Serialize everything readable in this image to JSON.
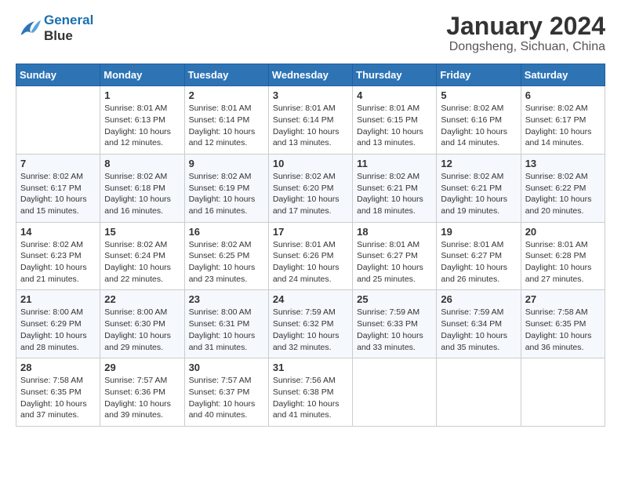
{
  "header": {
    "logo_line1": "General",
    "logo_line2": "Blue",
    "title": "January 2024",
    "subtitle": "Dongsheng, Sichuan, China"
  },
  "calendar": {
    "headers": [
      "Sunday",
      "Monday",
      "Tuesday",
      "Wednesday",
      "Thursday",
      "Friday",
      "Saturday"
    ],
    "rows": [
      [
        {
          "day": "",
          "info": ""
        },
        {
          "day": "1",
          "info": "Sunrise: 8:01 AM\nSunset: 6:13 PM\nDaylight: 10 hours\nand 12 minutes."
        },
        {
          "day": "2",
          "info": "Sunrise: 8:01 AM\nSunset: 6:14 PM\nDaylight: 10 hours\nand 12 minutes."
        },
        {
          "day": "3",
          "info": "Sunrise: 8:01 AM\nSunset: 6:14 PM\nDaylight: 10 hours\nand 13 minutes."
        },
        {
          "day": "4",
          "info": "Sunrise: 8:01 AM\nSunset: 6:15 PM\nDaylight: 10 hours\nand 13 minutes."
        },
        {
          "day": "5",
          "info": "Sunrise: 8:02 AM\nSunset: 6:16 PM\nDaylight: 10 hours\nand 14 minutes."
        },
        {
          "day": "6",
          "info": "Sunrise: 8:02 AM\nSunset: 6:17 PM\nDaylight: 10 hours\nand 14 minutes."
        }
      ],
      [
        {
          "day": "7",
          "info": "Sunrise: 8:02 AM\nSunset: 6:17 PM\nDaylight: 10 hours\nand 15 minutes."
        },
        {
          "day": "8",
          "info": "Sunrise: 8:02 AM\nSunset: 6:18 PM\nDaylight: 10 hours\nand 16 minutes."
        },
        {
          "day": "9",
          "info": "Sunrise: 8:02 AM\nSunset: 6:19 PM\nDaylight: 10 hours\nand 16 minutes."
        },
        {
          "day": "10",
          "info": "Sunrise: 8:02 AM\nSunset: 6:20 PM\nDaylight: 10 hours\nand 17 minutes."
        },
        {
          "day": "11",
          "info": "Sunrise: 8:02 AM\nSunset: 6:21 PM\nDaylight: 10 hours\nand 18 minutes."
        },
        {
          "day": "12",
          "info": "Sunrise: 8:02 AM\nSunset: 6:21 PM\nDaylight: 10 hours\nand 19 minutes."
        },
        {
          "day": "13",
          "info": "Sunrise: 8:02 AM\nSunset: 6:22 PM\nDaylight: 10 hours\nand 20 minutes."
        }
      ],
      [
        {
          "day": "14",
          "info": "Sunrise: 8:02 AM\nSunset: 6:23 PM\nDaylight: 10 hours\nand 21 minutes."
        },
        {
          "day": "15",
          "info": "Sunrise: 8:02 AM\nSunset: 6:24 PM\nDaylight: 10 hours\nand 22 minutes."
        },
        {
          "day": "16",
          "info": "Sunrise: 8:02 AM\nSunset: 6:25 PM\nDaylight: 10 hours\nand 23 minutes."
        },
        {
          "day": "17",
          "info": "Sunrise: 8:01 AM\nSunset: 6:26 PM\nDaylight: 10 hours\nand 24 minutes."
        },
        {
          "day": "18",
          "info": "Sunrise: 8:01 AM\nSunset: 6:27 PM\nDaylight: 10 hours\nand 25 minutes."
        },
        {
          "day": "19",
          "info": "Sunrise: 8:01 AM\nSunset: 6:27 PM\nDaylight: 10 hours\nand 26 minutes."
        },
        {
          "day": "20",
          "info": "Sunrise: 8:01 AM\nSunset: 6:28 PM\nDaylight: 10 hours\nand 27 minutes."
        }
      ],
      [
        {
          "day": "21",
          "info": "Sunrise: 8:00 AM\nSunset: 6:29 PM\nDaylight: 10 hours\nand 28 minutes."
        },
        {
          "day": "22",
          "info": "Sunrise: 8:00 AM\nSunset: 6:30 PM\nDaylight: 10 hours\nand 29 minutes."
        },
        {
          "day": "23",
          "info": "Sunrise: 8:00 AM\nSunset: 6:31 PM\nDaylight: 10 hours\nand 31 minutes."
        },
        {
          "day": "24",
          "info": "Sunrise: 7:59 AM\nSunset: 6:32 PM\nDaylight: 10 hours\nand 32 minutes."
        },
        {
          "day": "25",
          "info": "Sunrise: 7:59 AM\nSunset: 6:33 PM\nDaylight: 10 hours\nand 33 minutes."
        },
        {
          "day": "26",
          "info": "Sunrise: 7:59 AM\nSunset: 6:34 PM\nDaylight: 10 hours\nand 35 minutes."
        },
        {
          "day": "27",
          "info": "Sunrise: 7:58 AM\nSunset: 6:35 PM\nDaylight: 10 hours\nand 36 minutes."
        }
      ],
      [
        {
          "day": "28",
          "info": "Sunrise: 7:58 AM\nSunset: 6:35 PM\nDaylight: 10 hours\nand 37 minutes."
        },
        {
          "day": "29",
          "info": "Sunrise: 7:57 AM\nSunset: 6:36 PM\nDaylight: 10 hours\nand 39 minutes."
        },
        {
          "day": "30",
          "info": "Sunrise: 7:57 AM\nSunset: 6:37 PM\nDaylight: 10 hours\nand 40 minutes."
        },
        {
          "day": "31",
          "info": "Sunrise: 7:56 AM\nSunset: 6:38 PM\nDaylight: 10 hours\nand 41 minutes."
        },
        {
          "day": "",
          "info": ""
        },
        {
          "day": "",
          "info": ""
        },
        {
          "day": "",
          "info": ""
        }
      ]
    ]
  }
}
